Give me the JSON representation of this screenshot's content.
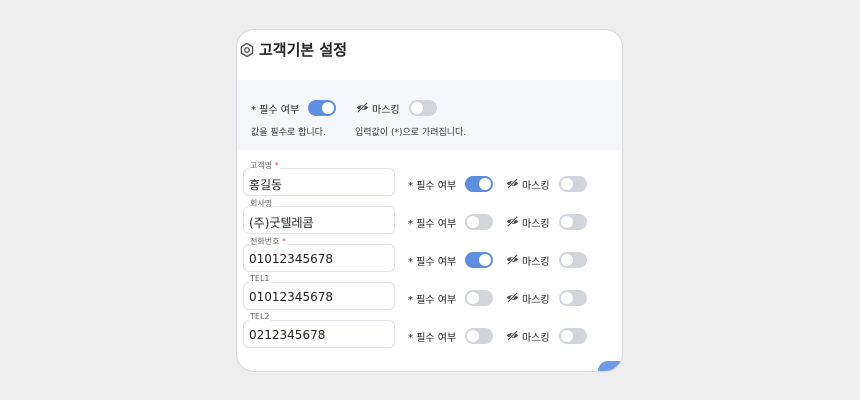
{
  "header": {
    "title": "고객기본 설정",
    "icon": "gear-icon"
  },
  "settings": {
    "required_label": "필수 여부",
    "required_star": "*",
    "required_on": true,
    "required_desc": "값을 필수로 합니다.",
    "masking_label": "마스킹",
    "masking_on": false,
    "masking_desc": "입력값이 (*)으로 가려집니다."
  },
  "row_labels": {
    "required": "필수 여부",
    "masking": "마스킹",
    "star": "*"
  },
  "fields": [
    {
      "label": "고객명",
      "required_mark": "*",
      "value": "홍길동",
      "required_on": true,
      "masking_on": false
    },
    {
      "label": "회사명",
      "required_mark": "",
      "value": "(주)굿텔레콤",
      "required_on": false,
      "masking_on": false
    },
    {
      "label": "전화번호",
      "required_mark": "*",
      "value": "01012345678",
      "required_on": true,
      "masking_on": false
    },
    {
      "label": "TEL1",
      "required_mark": "",
      "value": "01012345678",
      "required_on": false,
      "masking_on": false
    },
    {
      "label": "TEL2",
      "required_mark": "",
      "value": "0212345678",
      "required_on": false,
      "masking_on": false
    }
  ],
  "colors": {
    "toggle_on": "#5e8fe0",
    "toggle_off": "#d3d5dd",
    "required_mark": "#e0524a"
  }
}
